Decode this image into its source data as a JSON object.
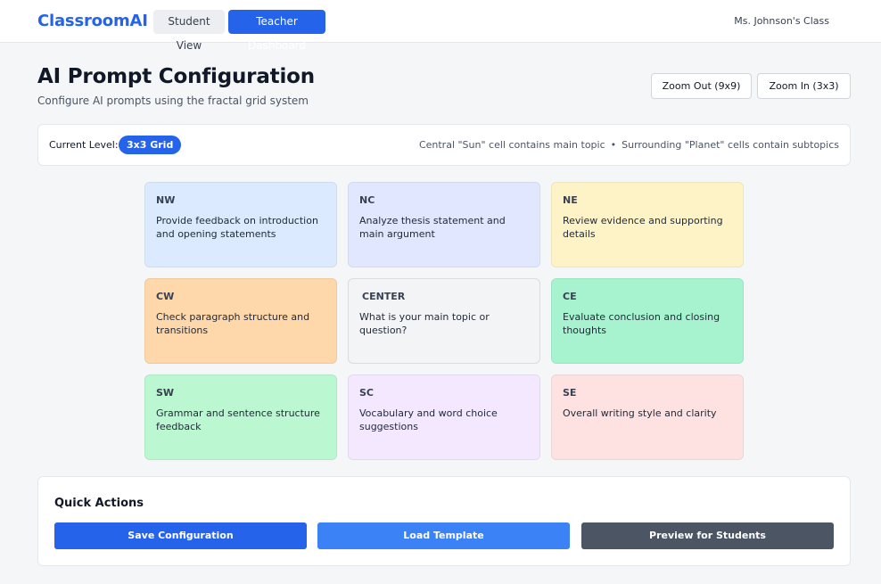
{
  "header": {
    "brand": "ClassroomAI",
    "nav": {
      "student_view": "Student View",
      "teacher_dashboard": "Teacher Dashboard"
    },
    "class_name": "Ms. Johnson's Class"
  },
  "page": {
    "title": "AI Prompt Configuration",
    "subtitle": "Configure AI prompts using the fractal grid system",
    "zoom_out": "Zoom Out (9x9)",
    "zoom_in": "Zoom In (3x3)"
  },
  "level": {
    "label": "Current Level:",
    "badge": "3x3 Grid",
    "info_sun": "Central \"Sun\" cell contains main topic",
    "info_sep": "•",
    "info_planet": "Surrounding \"Planet\" cells contain subtopics"
  },
  "grid": {
    "nw": {
      "code": "NW",
      "text": "Provide feedback on introduction and opening statements"
    },
    "nc": {
      "code": "NC",
      "text": "Analyze thesis statement and main argument"
    },
    "ne": {
      "code": "NE",
      "text": "Review evidence and supporting details"
    },
    "cw": {
      "code": "CW",
      "text": "Check paragraph structure and transitions"
    },
    "center": {
      "code": "CENTER",
      "text": "What is your main topic or question?"
    },
    "ce": {
      "code": "CE",
      "text": "Evaluate conclusion and closing thoughts"
    },
    "sw": {
      "code": "SW",
      "text": "Grammar and sentence structure feedback"
    },
    "sc": {
      "code": "SC",
      "text": "Vocabulary and word choice suggestions"
    },
    "se": {
      "code": "SE",
      "text": "Overall writing style and clarity"
    }
  },
  "actions": {
    "title": "Quick Actions",
    "save": "Save Configuration",
    "load": "Load Template",
    "preview": "Preview for Students"
  },
  "colors": {
    "accent": "#2563eb",
    "nw": "#dbeafe",
    "nc": "#e0e7ff",
    "ne": "#fef3c7",
    "cw": "#fed7aa",
    "center": "#f3f4f6",
    "ce": "#a7f3d0",
    "sw": "#bbf7d0",
    "sc": "#f3e8ff",
    "se": "#fee2e2"
  }
}
